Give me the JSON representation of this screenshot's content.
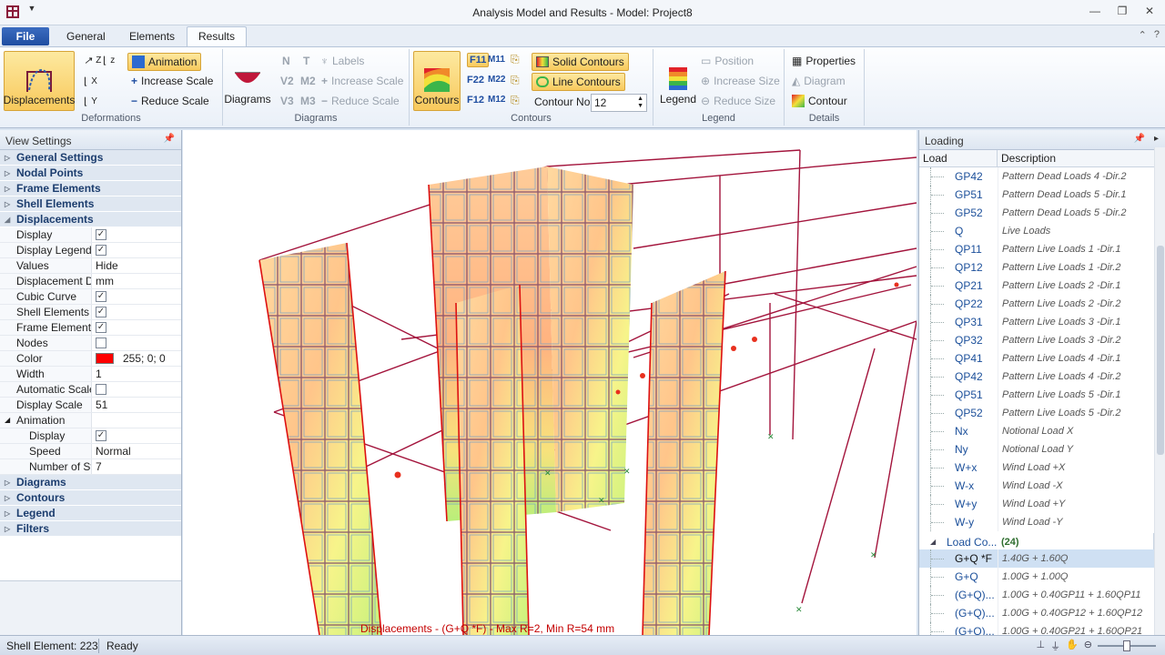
{
  "window": {
    "title": "Analysis Model and Results - Model: Project8"
  },
  "tabs": {
    "file": "File",
    "general": "General",
    "elements": "Elements",
    "results": "Results"
  },
  "ribbon": {
    "deformations": {
      "label": "Deformations",
      "displacements": "Displacements",
      "animation": "Animation",
      "increase_scale": "Increase Scale",
      "reduce_scale": "Reduce Scale",
      "axes": [
        "Z",
        "X",
        "Y"
      ]
    },
    "diagrams": {
      "label": "Diagrams",
      "diagrams_btn": "Diagrams",
      "labels": "Labels",
      "increase_scale": "Increase Scale",
      "reduce_scale": "Reduce Scale",
      "forces": [
        "N",
        "T",
        "V2",
        "M2",
        "V3",
        "M3"
      ]
    },
    "contours": {
      "label": "Contours",
      "contours_btn": "Contours",
      "solid_contours": "Solid Contours",
      "line_contours": "Line Contours",
      "contour_no_label": "Contour No",
      "contour_no_value": "12",
      "fkeys": [
        "F11",
        "M11",
        "F22",
        "M22",
        "F12",
        "M12"
      ]
    },
    "legend": {
      "label": "Legend",
      "legend_btn": "Legend",
      "position": "Position",
      "increase_size": "Increase Size",
      "reduce_size": "Reduce Size"
    },
    "details": {
      "label": "Details",
      "properties": "Properties",
      "diagram": "Diagram",
      "contour": "Contour"
    }
  },
  "view_settings": {
    "title": "View Settings",
    "categories_top": [
      "General Settings",
      "Nodal Points",
      "Frame Elements",
      "Shell Elements"
    ],
    "displacements": {
      "label": "Displacements",
      "rows": [
        {
          "name": "Display",
          "type": "check",
          "value": true
        },
        {
          "name": "Display Legend",
          "type": "check",
          "value": true
        },
        {
          "name": "Values",
          "type": "text",
          "value": "Hide"
        },
        {
          "name": "Displacement Dis",
          "type": "text",
          "value": "mm"
        },
        {
          "name": "Cubic Curve",
          "type": "check",
          "value": true
        },
        {
          "name": "Shell Elements",
          "type": "check",
          "value": true
        },
        {
          "name": "Frame Elements",
          "type": "check",
          "value": true
        },
        {
          "name": "Nodes",
          "type": "check",
          "value": false
        },
        {
          "name": "Color",
          "type": "color",
          "value": "255; 0; 0",
          "color": "#ff0000"
        },
        {
          "name": "Width",
          "type": "text",
          "value": "1"
        },
        {
          "name": "Automatic Scale",
          "type": "check",
          "value": false
        },
        {
          "name": "Display Scale",
          "type": "text",
          "value": "51"
        }
      ],
      "animation": {
        "label": "Animation",
        "rows": [
          {
            "name": "Display",
            "type": "check",
            "value": true
          },
          {
            "name": "Speed",
            "type": "text",
            "value": "Normal"
          },
          {
            "name": "Number of Ste",
            "type": "text",
            "value": "7"
          }
        ]
      }
    },
    "categories_bottom": [
      "Diagrams",
      "Contours",
      "Legend",
      "Filters"
    ]
  },
  "viewport": {
    "caption": "Displacements - (G+Q *F) - Max  R=2, Min  R=54 mm"
  },
  "loading": {
    "title": "Loading",
    "col_load": "Load",
    "col_desc": "Description",
    "rows": [
      {
        "load": "GP42",
        "desc": "Pattern Dead Loads 4 -Dir.2"
      },
      {
        "load": "GP51",
        "desc": "Pattern Dead Loads 5 -Dir.1"
      },
      {
        "load": "GP52",
        "desc": "Pattern Dead Loads 5 -Dir.2"
      },
      {
        "load": "Q",
        "desc": "Live Loads"
      },
      {
        "load": "QP11",
        "desc": "Pattern Live Loads 1 -Dir.1"
      },
      {
        "load": "QP12",
        "desc": "Pattern Live Loads 1 -Dir.2"
      },
      {
        "load": "QP21",
        "desc": "Pattern Live Loads 2 -Dir.1"
      },
      {
        "load": "QP22",
        "desc": "Pattern Live Loads 2 -Dir.2"
      },
      {
        "load": "QP31",
        "desc": "Pattern Live Loads 3 -Dir.1"
      },
      {
        "load": "QP32",
        "desc": "Pattern Live Loads 3 -Dir.2"
      },
      {
        "load": "QP41",
        "desc": "Pattern Live Loads 4 -Dir.1"
      },
      {
        "load": "QP42",
        "desc": "Pattern Live Loads 4 -Dir.2"
      },
      {
        "load": "QP51",
        "desc": "Pattern Live Loads 5 -Dir.1"
      },
      {
        "load": "QP52",
        "desc": "Pattern Live Loads 5 -Dir.2"
      },
      {
        "load": "Nx",
        "desc": "Notional Load X"
      },
      {
        "load": "Ny",
        "desc": "Notional Load Y"
      },
      {
        "load": "W+x",
        "desc": "Wind Load +X"
      },
      {
        "load": "W-x",
        "desc": "Wind Load -X"
      },
      {
        "load": "W+y",
        "desc": "Wind Load +Y"
      },
      {
        "load": "W-y",
        "desc": "Wind Load -Y"
      }
    ],
    "group": {
      "label": "Load Co...",
      "count": "(24)"
    },
    "combos": [
      {
        "load": "G+Q *F",
        "desc": "1.40G + 1.60Q",
        "selected": true
      },
      {
        "load": "G+Q",
        "desc": "1.00G + 1.00Q"
      },
      {
        "load": "(G+Q)...",
        "desc": "1.00G + 0.40GP11 + 1.60QP11"
      },
      {
        "load": "(G+Q)...",
        "desc": "1.00G + 0.40GP12 + 1.60QP12"
      },
      {
        "load": "(G+Q)...",
        "desc": "1.00G + 0.40GP21 + 1.60QP21"
      }
    ]
  },
  "status": {
    "element": "Shell Element: 223",
    "state": "Ready"
  },
  "colors": {
    "accent": "#1f4ea1",
    "highlight": "#f8c95c",
    "frame": "#a3143c",
    "selection": "#cfe0f3"
  }
}
